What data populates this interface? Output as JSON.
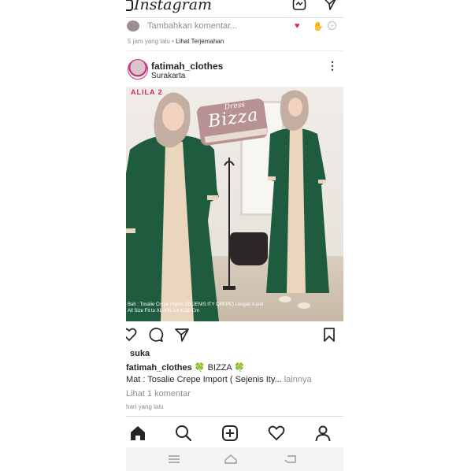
{
  "app": {
    "title": "Instagram"
  },
  "prev_post": {
    "comment_placeholder": "Tambahkan komentar...",
    "time": "5 jam yang lalu",
    "separator": "•",
    "translate_link": "Lihat Terjemahan",
    "quick_reactions": [
      "heart",
      "raised-hands"
    ]
  },
  "post": {
    "username": "fatimah_clothes",
    "location": "Surakarta",
    "image": {
      "brand_watermark": "ALILA 2",
      "badge_small": "Dress",
      "badge_title": "Bizza",
      "overlay_line1": "Bah : Tosalie Crepe Import (SEJENIS ITY CREPE) Lengan Karet",
      "overlay_line2": "All Size Fit to XL-XXL Ld ±110 Cm",
      "dress_color": "#1f5c3f",
      "panel_color": "#ead5bd"
    },
    "likes_text": "suka",
    "caption_user": "fatimah_clothes",
    "caption_title": "BIZZA",
    "caption_emoji": "🍀",
    "caption_line2": "Mat : Tosalie Crepe Import ( Sejenis Ity...",
    "caption_more": "lainnya",
    "view_comments": "Lihat 1 komentar",
    "time": "hari yang lalu"
  },
  "nav": {
    "items": [
      "home-icon",
      "search-icon",
      "add-post-icon",
      "activity-heart-icon",
      "profile-icon"
    ]
  },
  "colors": {
    "accent_like": "#e0245e",
    "text": "#262626",
    "muted": "#8e8e8e"
  }
}
